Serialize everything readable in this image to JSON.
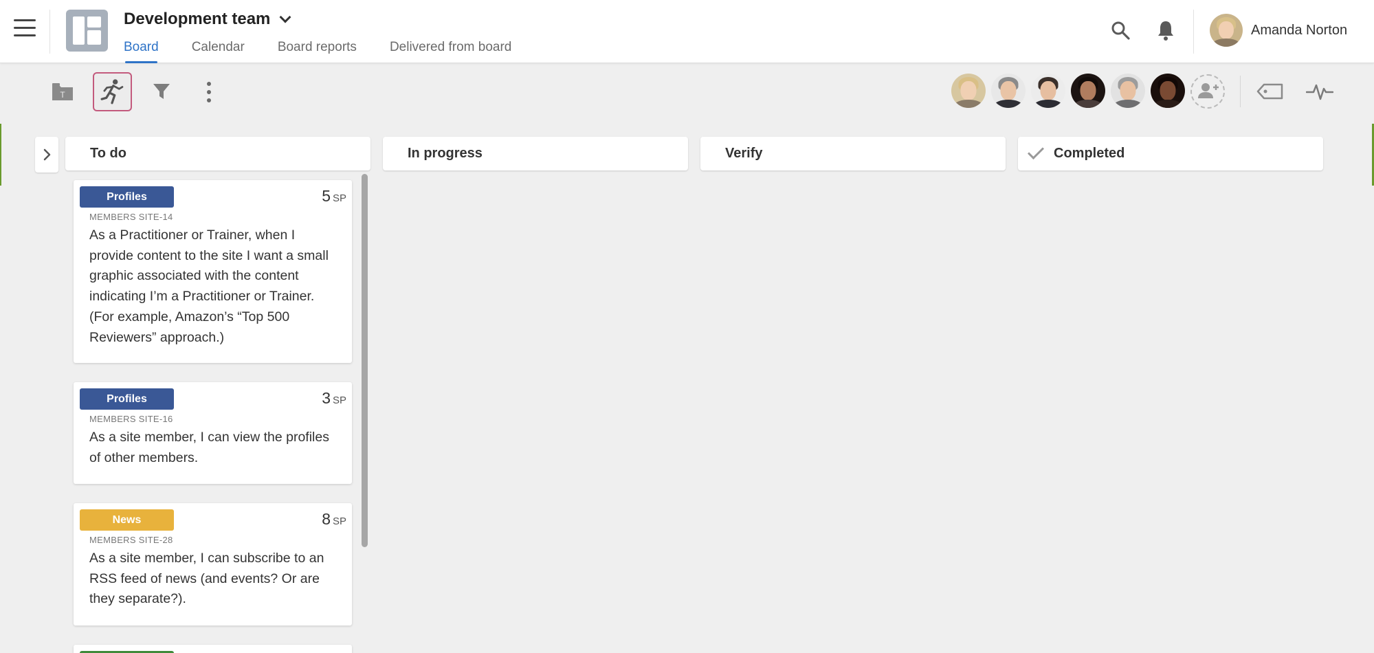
{
  "header": {
    "title": "Development team",
    "tabs": [
      {
        "label": "Board",
        "active": true
      },
      {
        "label": "Calendar",
        "active": false
      },
      {
        "label": "Board reports",
        "active": false
      },
      {
        "label": "Delivered from board",
        "active": false
      }
    ],
    "user_name": "Amanda Norton",
    "icons": [
      "hamburger-menu-icon",
      "board-logo-icon",
      "chevron-down-icon",
      "search-icon",
      "bell-icon"
    ],
    "accent_color": "#2e73c7"
  },
  "toolbar": {
    "icons": [
      "folder-icon",
      "runner-icon",
      "filter-icon",
      "more-vertical-icon",
      "add-member-icon",
      "tag-icon",
      "pulse-icon"
    ],
    "active_outline_color": "#c35a7d",
    "member_count": 6
  },
  "columns": [
    {
      "title": "To do"
    },
    {
      "title": "In progress"
    },
    {
      "title": "Verify"
    },
    {
      "title": "Completed",
      "icon": "check-icon"
    }
  ],
  "cards": [
    {
      "tag": "Profiles",
      "tag_color": "#3a5896",
      "points": "5",
      "unit": "SP",
      "id": "MEMBERS SITE-14",
      "text": "As a Practitioner or Trainer, when I provide content to the site I want a small graphic associated with the content indicating I’m a Practitioner or Trainer. (For example, Amazon’s “Top 500 Reviewers” approach.)"
    },
    {
      "tag": "Profiles",
      "tag_color": "#3a5896",
      "points": "3",
      "unit": "SP",
      "id": "MEMBERS SITE-16",
      "text": "As a site member, I can view the profiles of other members."
    },
    {
      "tag": "News",
      "tag_color": "#e8b23c",
      "points": "8",
      "unit": "SP",
      "id": "MEMBERS SITE-28",
      "text": "As a site member, I can subscribe to an RSS feed of news (and events? Or are they separate?)."
    },
    {
      "tag": "",
      "tag_color": "#3f8a3a",
      "points": "",
      "unit": "",
      "id": "",
      "text": ""
    }
  ]
}
